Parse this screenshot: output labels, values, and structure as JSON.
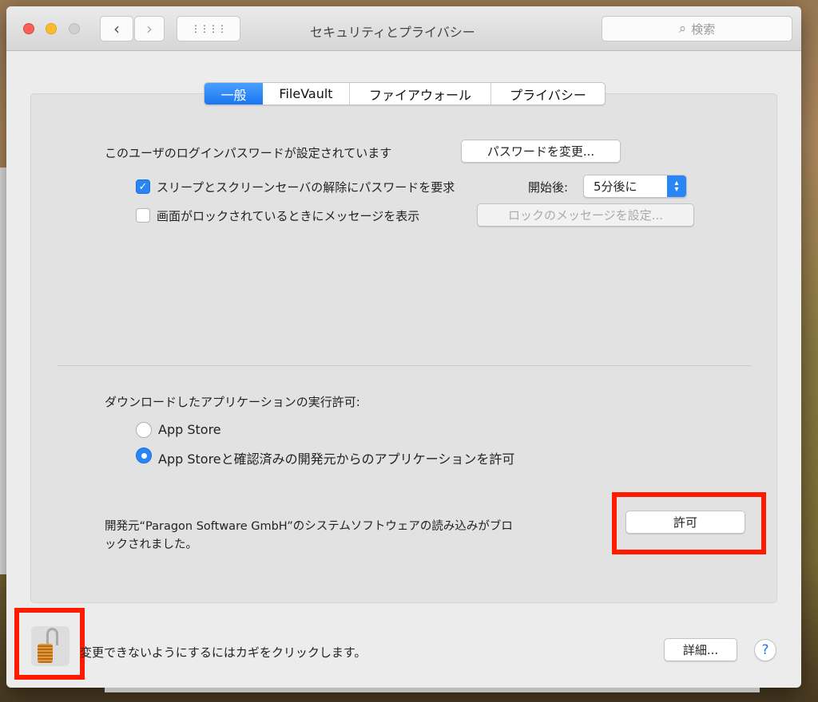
{
  "window": {
    "title": "セキュリティとプライバシー",
    "search_placeholder": "検索"
  },
  "tabs": [
    {
      "label": "一般",
      "selected": true
    },
    {
      "label": "FileVault"
    },
    {
      "label": "ファイアウォール"
    },
    {
      "label": "プライバシー"
    }
  ],
  "general": {
    "login_password_text": "このユーザのログインパスワードが設定されています",
    "change_password_button": "パスワードを変更...",
    "require_password_label": "スリープとスクリーンセーバの解除にパスワードを要求",
    "require_password_checked": true,
    "start_after_label": "開始後:",
    "start_after_value": "5分後に",
    "show_message_label": "画面がロックされているときにメッセージを表示",
    "show_message_checked": false,
    "set_lock_message_button": "ロックのメッセージを設定...",
    "allow_apps_heading": "ダウンロードしたアプリケーションの実行許可:",
    "radio_options": [
      {
        "label": "App Store",
        "selected": false
      },
      {
        "label": "App Storeと確認済みの開発元からのアプリケーションを許可",
        "selected": true
      }
    ],
    "blocked_message_line1": "開発元“Paragon Software GmbH”のシステムソフトウェアの読み込みがブロ",
    "blocked_message_line2": "ックされました。",
    "allow_button": "許可"
  },
  "footer": {
    "lock_text": "変更できないようにするにはカギをクリックします。",
    "advanced_button": "詳細...",
    "help_label": "?"
  },
  "colors": {
    "accent": "#1a76f0",
    "highlight": "#ff1a00"
  }
}
